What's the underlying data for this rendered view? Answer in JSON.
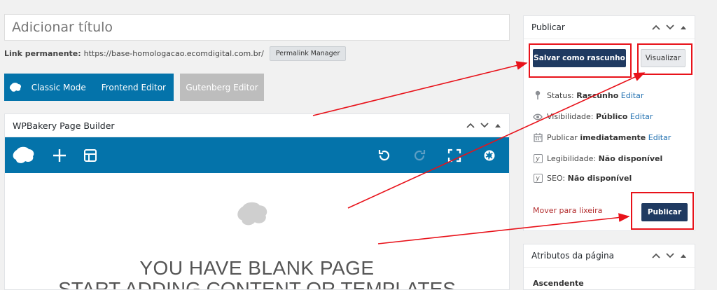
{
  "title_input": {
    "placeholder": "Adicionar título"
  },
  "permalink": {
    "label": "Link permanente:",
    "url": "https://base-homologacao.ecomdigital.com.br/",
    "manager_button": "Permalink Manager"
  },
  "editor_switch": {
    "classic_mode": "Classic Mode",
    "frontend_editor": "Frontend Editor",
    "gutenberg_editor": "Gutenberg Editor"
  },
  "wpbakery": {
    "title": "WPBakery Page Builder",
    "blank_line1": "YOU HAVE BLANK PAGE",
    "blank_line2": "START ADDING CONTENT OR TEMPLATES"
  },
  "publish_box": {
    "title": "Publicar",
    "save_draft": "Salvar como rascunho",
    "preview": "Visualizar",
    "status_label": "Status:",
    "status_value": "Rascunho",
    "status_edit": "Editar",
    "visibility_label": "Visibilidade:",
    "visibility_value": "Público",
    "visibility_edit": "Editar",
    "publish_label": "Publicar",
    "publish_value": "imediatamente",
    "publish_edit": "Editar",
    "readability_label": "Legibilidade:",
    "readability_value": "Não disponível",
    "seo_label": "SEO:",
    "seo_value": "Não disponível",
    "trash": "Mover para lixeira",
    "publish_button": "Publicar"
  },
  "attributes_box": {
    "title": "Atributos da página",
    "parent_label": "Ascendente"
  },
  "colors": {
    "wpb_blue": "#0473aa",
    "wp_primary": "#1f3a61",
    "annotation_red": "#e8121a",
    "trash_red": "#b32d2e"
  }
}
